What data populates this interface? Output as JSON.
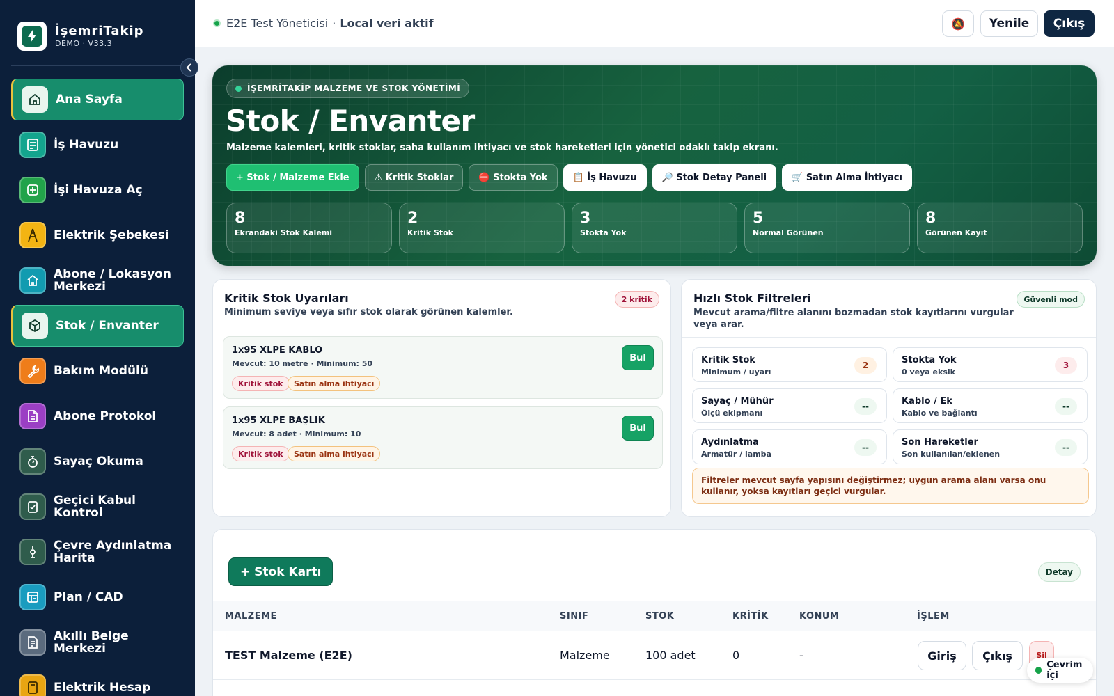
{
  "brand": {
    "title": "İşemriTakip",
    "subtitle": "DEMO · V33.3"
  },
  "sidebar": {
    "items": [
      {
        "label": "Ana Sayfa",
        "icon": "home-icon",
        "color": "#e8f5ee",
        "active": true
      },
      {
        "label": "İş Havuzu",
        "icon": "list-icon",
        "color": "#14a58e"
      },
      {
        "label": "İşi Havuza Aç",
        "icon": "plus-square-icon",
        "color": "#22a34a"
      },
      {
        "label": "Elektrik Şebekesi",
        "icon": "tower-icon",
        "color": "#f3b413"
      },
      {
        "label": "Abone / Lokasyon Merkezi",
        "icon": "building-icon",
        "color": "#129bb0"
      },
      {
        "label": "Stok / Envanter",
        "icon": "box-icon",
        "color": "#e8f5ee",
        "active": true
      },
      {
        "label": "Bakım Modülü",
        "icon": "wrench-icon",
        "color": "#ef7d1a"
      },
      {
        "label": "Abone Protokol",
        "icon": "document-icon",
        "color": "#9b3fc4"
      },
      {
        "label": "Sayaç Okuma",
        "icon": "stopwatch-icon",
        "color": "#2f5c4c"
      },
      {
        "label": "Geçici Kabul Kontrol",
        "icon": "check-clipboard-icon",
        "color": "#2f5c4c"
      },
      {
        "label": "Çevre Aydınlatma Harita",
        "icon": "lamp-icon",
        "color": "#2f5c4c"
      },
      {
        "label": "Plan / CAD",
        "icon": "blueprint-icon",
        "color": "#1a9cbf"
      },
      {
        "label": "Akıllı Belge Merkezi",
        "icon": "file-icon",
        "color": "#5b6b7e"
      },
      {
        "label": "Elektrik Hesap",
        "icon": "calculator-icon",
        "color": "#e9a512"
      }
    ]
  },
  "topbar": {
    "user": "E2E Test Yöneticisi",
    "separator": "·",
    "status": "Local veri aktif",
    "refresh_label": "Yenile",
    "logout_label": "Çıkış",
    "notification_icon": "🔕"
  },
  "hero": {
    "pill": "İŞEMRİTAKİP MALZEME VE STOK YÖNETİMİ",
    "title": "Stok / Envanter",
    "subtitle": "Malzeme kalemleri, kritik stoklar, saha kullanım ihtiyacı ve stok hareketleri için yönetici odaklı takip ekranı.",
    "actions": [
      {
        "label": "+ Stok / Malzeme Ekle",
        "style": "green"
      },
      {
        "label": "⚠ Kritik Stoklar",
        "style": "ghost"
      },
      {
        "label": "⛔ Stokta Yok",
        "style": "ghost"
      },
      {
        "label": "📋 İş Havuzu",
        "style": "white"
      },
      {
        "label": "🔎 Stok Detay Paneli",
        "style": "white"
      },
      {
        "label": "🛒 Satın Alma İhtiyacı",
        "style": "white"
      }
    ],
    "stats": [
      {
        "value": "8",
        "label": "Ekrandaki Stok Kalemi"
      },
      {
        "value": "2",
        "label": "Kritik Stok"
      },
      {
        "value": "3",
        "label": "Stokta Yok"
      },
      {
        "value": "5",
        "label": "Normal Görünen"
      },
      {
        "value": "8",
        "label": "Görünen Kayıt"
      }
    ]
  },
  "critical": {
    "title": "Kritik Stok Uyarıları",
    "subtitle": "Minimum seviye veya sıfır stok olarak görünen kalemler.",
    "badge": "2 kritik",
    "items": [
      {
        "name": "1x95 XLPE KABLO",
        "meta": "Mevcut: 10 metre · Minimum: 50",
        "tag1": "Kritik stok",
        "tag2": "Satın alma ihtiyacı",
        "button": "Bul"
      },
      {
        "name": "1x95 XLPE BAŞLIK",
        "meta": "Mevcut: 8 adet · Minimum: 10",
        "tag1": "Kritik stok",
        "tag2": "Satın alma ihtiyacı",
        "button": "Bul"
      }
    ]
  },
  "filters": {
    "title": "Hızlı Stok Filtreleri",
    "subtitle": "Mevcut arama/filtre alanını bozmadan stok kayıtlarını vurgular veya arar.",
    "badge": "Güvenli mod",
    "items": [
      {
        "title": "Kritik Stok",
        "sub": "Minimum / uyarı",
        "count": "2",
        "tone": "orange"
      },
      {
        "title": "Stokta Yok",
        "sub": "0 veya eksik",
        "count": "3",
        "tone": "red"
      },
      {
        "title": "Sayaç / Mühür",
        "sub": "Ölçü ekipmanı",
        "count": "--",
        "tone": "green"
      },
      {
        "title": "Kablo / Ek",
        "sub": "Kablo ve bağlantı",
        "count": "--",
        "tone": "green"
      },
      {
        "title": "Aydınlatma",
        "sub": "Armatür / lamba",
        "count": "--",
        "tone": "green"
      },
      {
        "title": "Son Hareketler",
        "sub": "Son kullanılan/eklenen",
        "count": "--",
        "tone": "green"
      }
    ],
    "note": "Filtreler mevcut sayfa yapısını değiştirmez; uygun arama alanı varsa onu kullanır, yoksa kayıtları geçici vurgular."
  },
  "table": {
    "add_button": "+ Stok Kartı",
    "detail_badge": "Detay",
    "headers": [
      "MALZEME",
      "SINIF",
      "STOK",
      "KRİTİK",
      "KONUM",
      "İŞLEM"
    ],
    "rows": [
      {
        "name": "TEST Malzeme (E2E)",
        "class": "Malzeme",
        "stock": "100 adet",
        "critical": "0",
        "location": "-",
        "in_label": "Giriş",
        "out_label": "Çıkış",
        "delete_label": "Sil"
      }
    ]
  },
  "connection": {
    "label": "Çevrim içi"
  }
}
